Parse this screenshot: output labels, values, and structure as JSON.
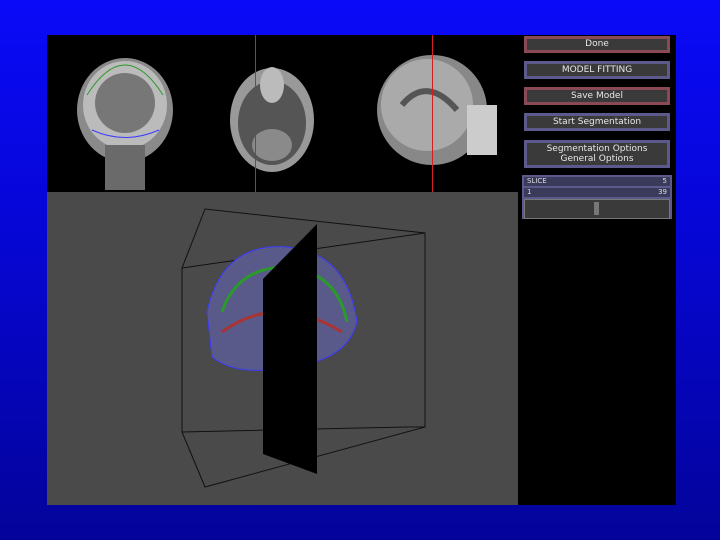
{
  "buttons": {
    "done": "Done",
    "model_fitting": "MODEL FITTING",
    "save_model": "Save Model",
    "start_segmentation": "Start Segmentation",
    "segmentation_options": "Segmentation Options",
    "general_options": "General Options"
  },
  "slider": {
    "label": "SLICE",
    "current": "5",
    "min": "1",
    "max": "39",
    "fraction": 0.48
  },
  "colors": {
    "background": "#0a0af8",
    "red_border": "#8a4a55",
    "blue_border": "#5c5a8c",
    "viewport": "#4a4a4a"
  }
}
